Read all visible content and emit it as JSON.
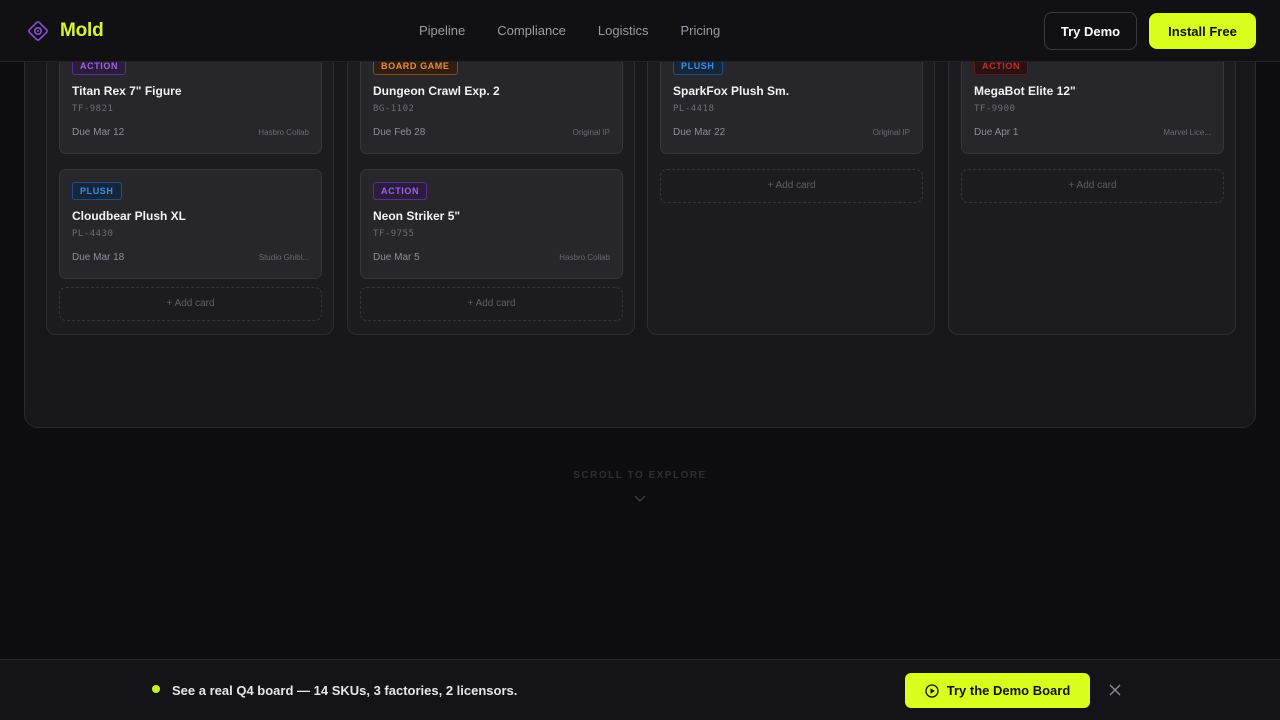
{
  "brand": {
    "name": "Mold",
    "accent": "#d7f531"
  },
  "nav": {
    "links": [
      "Pipeline",
      "Compliance",
      "Logistics",
      "Pricing"
    ],
    "try_demo": "Try Demo",
    "install_free": "Install Free"
  },
  "board": {
    "add_card_label": "+ Add card",
    "columns": [
      {
        "cards": [
          {
            "tag": "ACTION",
            "title": "Titan Rex 7\" Figure",
            "sku": "TF-9821",
            "due": "Due Mar 12",
            "source": "Hasbro Collab"
          },
          {
            "tag": "PLUSH",
            "title": "Cloudbear Plush XL",
            "sku": "PL-4430",
            "due": "Due Mar 18",
            "source": "Studio Ghibl..."
          }
        ]
      },
      {
        "cards": [
          {
            "tag": "BOARD GAME",
            "title": "Dungeon Crawl Exp. 2",
            "sku": "BG-1102",
            "due": "Due Feb 28",
            "source": "Original IP"
          },
          {
            "tag": "ACTION",
            "title": "Neon Striker 5\"",
            "sku": "TF-9755",
            "due": "Due Mar 5",
            "source": "Hasbro Collab"
          }
        ]
      },
      {
        "cards": [
          {
            "tag": "PLUSH",
            "title": "SparkFox Plush Sm.",
            "sku": "PL-4418",
            "due": "Due Mar 22",
            "source": "Original IP"
          }
        ]
      },
      {
        "cards": [
          {
            "tag": "ACTION",
            "title": "MegaBot Elite 12\"",
            "sku": "TF-9900",
            "due": "Due Apr 1",
            "source": "Marvel Lice..."
          }
        ]
      }
    ],
    "tag_colors": {
      "action": "#8a4fd8",
      "plush": "#2f7fd6",
      "board_game": "#e07a26",
      "action_alert": "#b3261e",
      "alert_dot": "#e24b3c"
    }
  },
  "scroll_hint": "SCROLL TO EXPLORE",
  "banner": {
    "text": "See a real Q4 board — 14 SKUs, 3 factories, 2 licensors.",
    "button": "Try the Demo Board"
  }
}
